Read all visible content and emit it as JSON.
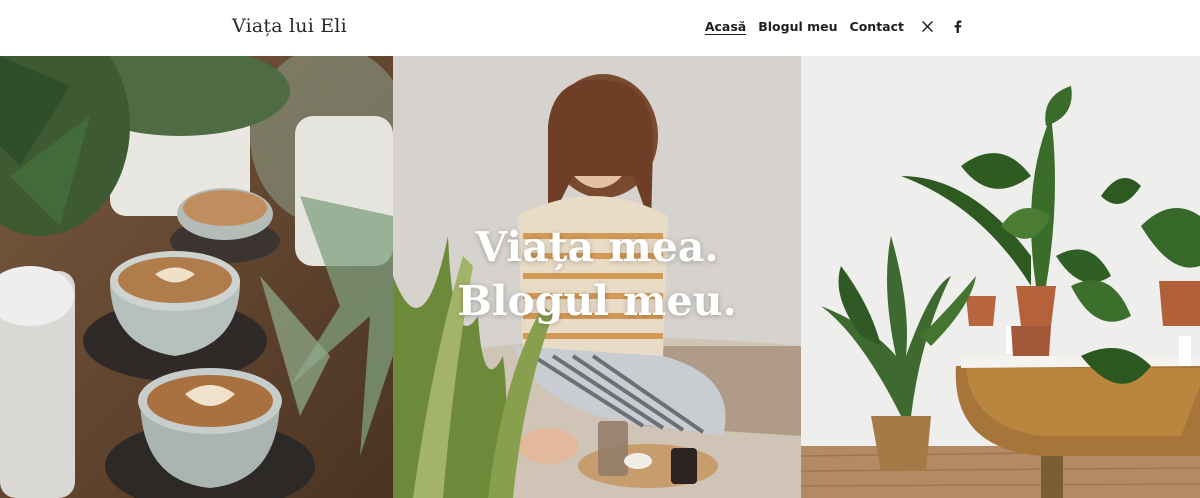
{
  "header": {
    "site_title": "Viața lui Eli",
    "nav": [
      {
        "label": "Acasă",
        "active": true
      },
      {
        "label": "Blogul meu",
        "active": false
      },
      {
        "label": "Contact",
        "active": false
      }
    ],
    "social": [
      "x-icon",
      "facebook-icon"
    ]
  },
  "hero": {
    "title_line1": "Viața mea.",
    "title_line2": "Blogul meu.",
    "images": [
      "coffee-plants-photo",
      "woman-sitting-photo",
      "plants-bathtub-photo"
    ]
  },
  "colors": {
    "text": "#1f1f1f",
    "hero_text": "#ffffff",
    "header_bg": "#ffffff"
  }
}
